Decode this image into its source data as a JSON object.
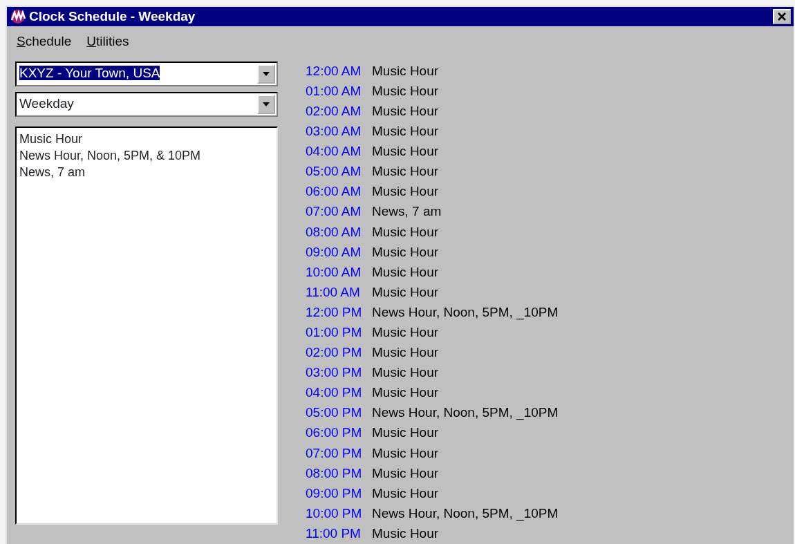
{
  "window": {
    "title": "Clock Schedule - Weekday"
  },
  "menu": [
    {
      "label": "Schedule"
    },
    {
      "label": "Utilities"
    }
  ],
  "station_combo": {
    "value": "KXYZ - Your Town, USA",
    "highlighted": true
  },
  "day_combo": {
    "value": "Weekday",
    "highlighted": false
  },
  "clock_list": [
    "Music Hour",
    "News Hour, Noon, 5PM, & 10PM",
    "News, 7 am"
  ],
  "schedule": [
    {
      "time": "12:00 AM",
      "clock": "Music Hour"
    },
    {
      "time": "01:00 AM",
      "clock": "Music Hour"
    },
    {
      "time": "02:00 AM",
      "clock": "Music Hour"
    },
    {
      "time": "03:00 AM",
      "clock": "Music Hour"
    },
    {
      "time": "04:00 AM",
      "clock": "Music Hour"
    },
    {
      "time": "05:00 AM",
      "clock": "Music Hour"
    },
    {
      "time": "06:00 AM",
      "clock": "Music Hour"
    },
    {
      "time": "07:00 AM",
      "clock": "News, 7 am"
    },
    {
      "time": "08:00 AM",
      "clock": "Music Hour"
    },
    {
      "time": "09:00 AM",
      "clock": "Music Hour"
    },
    {
      "time": "10:00 AM",
      "clock": "Music Hour"
    },
    {
      "time": "11:00 AM",
      "clock": "Music Hour"
    },
    {
      "time": "12:00 PM",
      "clock": "News Hour, Noon, 5PM, _10PM"
    },
    {
      "time": "01:00 PM",
      "clock": "Music Hour"
    },
    {
      "time": "02:00 PM",
      "clock": "Music Hour"
    },
    {
      "time": "03:00 PM",
      "clock": "Music Hour"
    },
    {
      "time": "04:00 PM",
      "clock": "Music Hour"
    },
    {
      "time": "05:00 PM",
      "clock": "News Hour, Noon, 5PM, _10PM"
    },
    {
      "time": "06:00 PM",
      "clock": "Music Hour"
    },
    {
      "time": "07:00 PM",
      "clock": "Music Hour"
    },
    {
      "time": "08:00 PM",
      "clock": "Music Hour"
    },
    {
      "time": "09:00 PM",
      "clock": "Music Hour"
    },
    {
      "time": "10:00 PM",
      "clock": "News Hour, Noon, 5PM, _10PM"
    },
    {
      "time": "11:00 PM",
      "clock": "Music Hour"
    }
  ]
}
